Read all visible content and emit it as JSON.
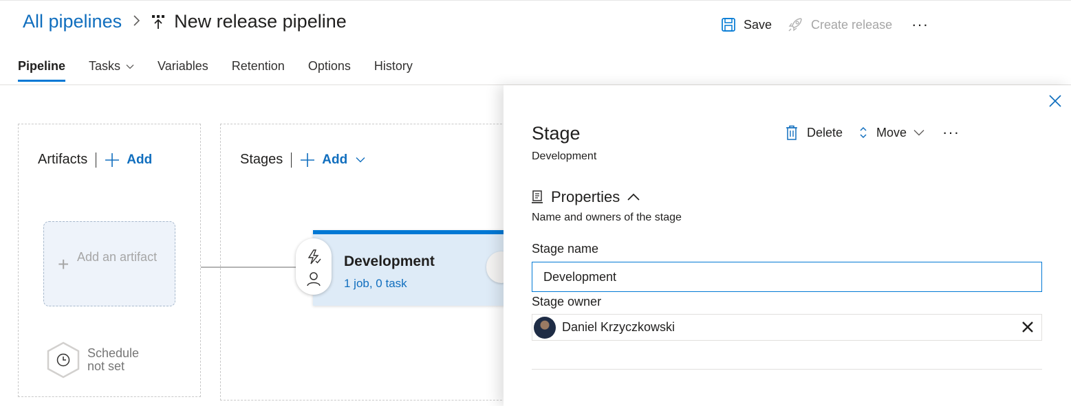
{
  "breadcrumb": {
    "root": "All pipelines",
    "separator": ">",
    "title": "New release pipeline",
    "icon": "pipeline-icon"
  },
  "toolbar": {
    "save_label": "Save",
    "create_release_label": "Create release",
    "more_label": "···"
  },
  "tabs": [
    {
      "label": "Pipeline",
      "active": true
    },
    {
      "label": "Tasks",
      "has_dropdown": true
    },
    {
      "label": "Variables"
    },
    {
      "label": "Retention"
    },
    {
      "label": "Options"
    },
    {
      "label": "History"
    }
  ],
  "artifacts": {
    "title": "Artifacts",
    "add_label": "Add",
    "card_text": "Add an artifact",
    "schedule_text": "Schedule not set"
  },
  "stages": {
    "title": "Stages",
    "add_label": "Add",
    "card": {
      "name": "Development",
      "summary": "1 job, 0 task"
    }
  },
  "panel": {
    "title": "Stage",
    "subtitle": "Development",
    "delete_label": "Delete",
    "move_label": "Move",
    "more_label": "···",
    "section_title": "Properties",
    "section_subtitle": "Name and owners of the stage",
    "stage_name_label": "Stage name",
    "stage_name_value": "Development",
    "stage_owner_label": "Stage owner",
    "stage_owner_value": "Daniel Krzyczkowski"
  },
  "colors": {
    "accent": "#0078d4",
    "link": "#106ebe",
    "stage_bg": "#deebf7"
  }
}
